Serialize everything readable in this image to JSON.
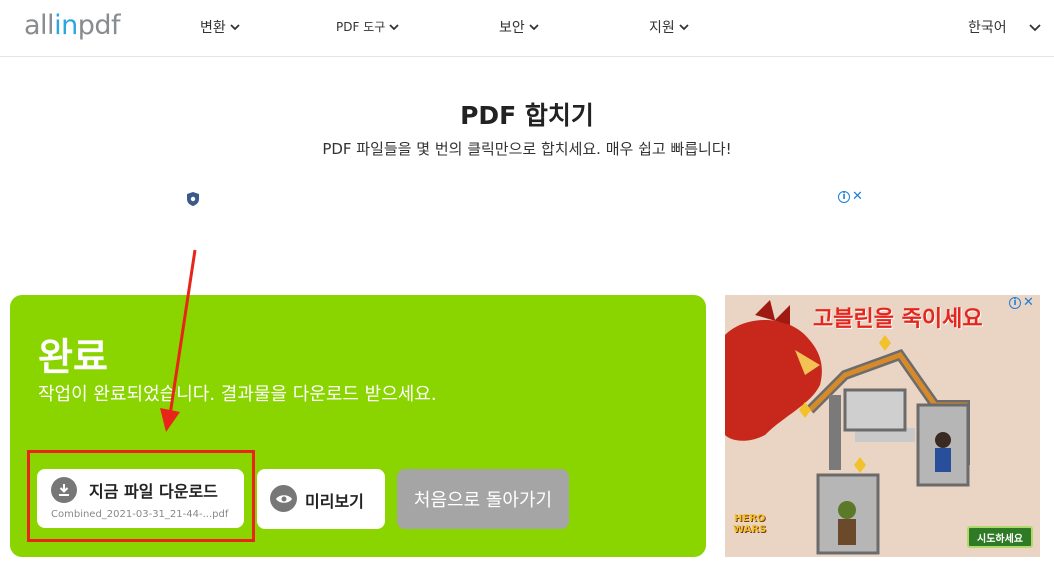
{
  "header": {
    "logo": {
      "part1": "all",
      "part2": "in",
      "part3": "pdf"
    },
    "nav": [
      {
        "label": "변환"
      },
      {
        "label": "PDF 도구"
      },
      {
        "label": "보안"
      },
      {
        "label": "지원"
      }
    ],
    "language": "한국어"
  },
  "page": {
    "title": "PDF 합치기",
    "subtitle": "PDF 파일들을 몇 번의 클릭만으로 합치세요. 매우 쉽고 빠릅니다!"
  },
  "result": {
    "title": "완료",
    "message": "작업이 완료되었습니다. 결과물을 다운로드 받으세요.",
    "download_label": "지금 파일 다운로드",
    "download_filename": "Combined_2021-03-31_21-44-...pdf",
    "preview_label": "미리보기",
    "restart_label": "처음으로 돌아가기"
  },
  "ad": {
    "headline": "고블린을 죽이세요",
    "cta": "시도하세요",
    "logo_line1": "HERO",
    "logo_line2": "WARS"
  },
  "colors": {
    "panel_green": "#8ad400",
    "annotation_red": "#e8241b",
    "logo_blue": "#2aa6e6"
  },
  "icons": [
    "chevron-down-icon",
    "download-icon",
    "eye-icon",
    "shield-icon",
    "info-icon",
    "close-icon"
  ]
}
